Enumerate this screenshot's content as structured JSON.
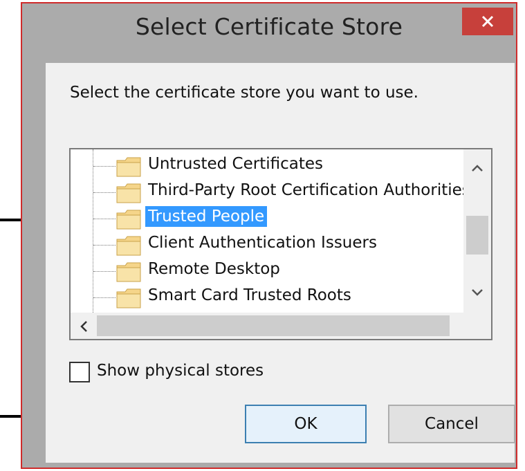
{
  "window": {
    "title": "Select Certificate Store",
    "close_icon": "close-icon",
    "accent_close": "#c7403b",
    "border_color": "#cf2b2b"
  },
  "dialog": {
    "prompt": "Select the certificate store you want to use."
  },
  "tree": {
    "items": [
      {
        "label": "Untrusted Certificates",
        "icon": "folder-icon",
        "selected": false
      },
      {
        "label": "Third-Party Root Certification Authorities",
        "icon": "folder-icon",
        "selected": false
      },
      {
        "label": "Trusted People",
        "icon": "folder-icon",
        "selected": true
      },
      {
        "label": "Client Authentication Issuers",
        "icon": "folder-icon",
        "selected": false
      },
      {
        "label": "Remote Desktop",
        "icon": "folder-icon",
        "selected": false
      },
      {
        "label": "Smart Card Trusted Roots",
        "icon": "folder-icon",
        "selected": false
      }
    ],
    "selection_color": "#3399ff"
  },
  "options": {
    "show_physical_stores_label": "Show physical stores",
    "show_physical_stores_checked": false
  },
  "buttons": {
    "ok_label": "OK",
    "cancel_label": "Cancel"
  }
}
